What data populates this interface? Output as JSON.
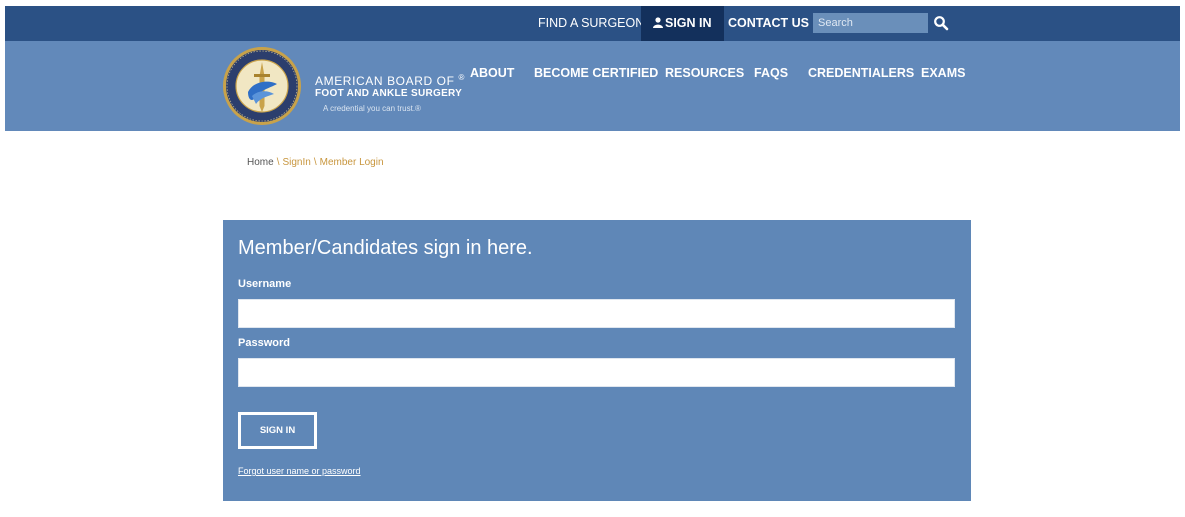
{
  "topbar": {
    "find_surgeon": "FIND A SURGEON",
    "sign_in": "SIGN IN",
    "contact_us": "CONTACT US",
    "search_placeholder": "Search"
  },
  "brand": {
    "line1": "AMERICAN BOARD OF",
    "registered": "®",
    "line2": "FOOT AND ANKLE SURGERY",
    "tagline": "A credential you can trust.®"
  },
  "nav": {
    "items": [
      {
        "label": "ABOUT"
      },
      {
        "label": "BECOME CERTIFIED"
      },
      {
        "label": "RESOURCES"
      },
      {
        "label": "FAQS"
      },
      {
        "label": "CREDENTIALERS"
      },
      {
        "label": "EXAMS"
      }
    ]
  },
  "breadcrumb": {
    "home": "Home",
    "separator": "\\",
    "signin": "SignIn",
    "current": "Member Login"
  },
  "login": {
    "title": "Member/Candidates sign in here.",
    "username_label": "Username",
    "username_value": "",
    "password_label": "Password",
    "password_value": "",
    "submit_label": "SIGN IN",
    "forgot_label": "Forgot user name or password"
  },
  "icons": {
    "person": "person-icon",
    "search": "search-icon",
    "logo": "seal-logo-icon"
  },
  "colors": {
    "topbar": "#2b5185",
    "topbar_active": "#13305c",
    "mainnav": "#6289ba",
    "panel": "#5f87b7",
    "breadcrumb_link": "#c8963e"
  }
}
